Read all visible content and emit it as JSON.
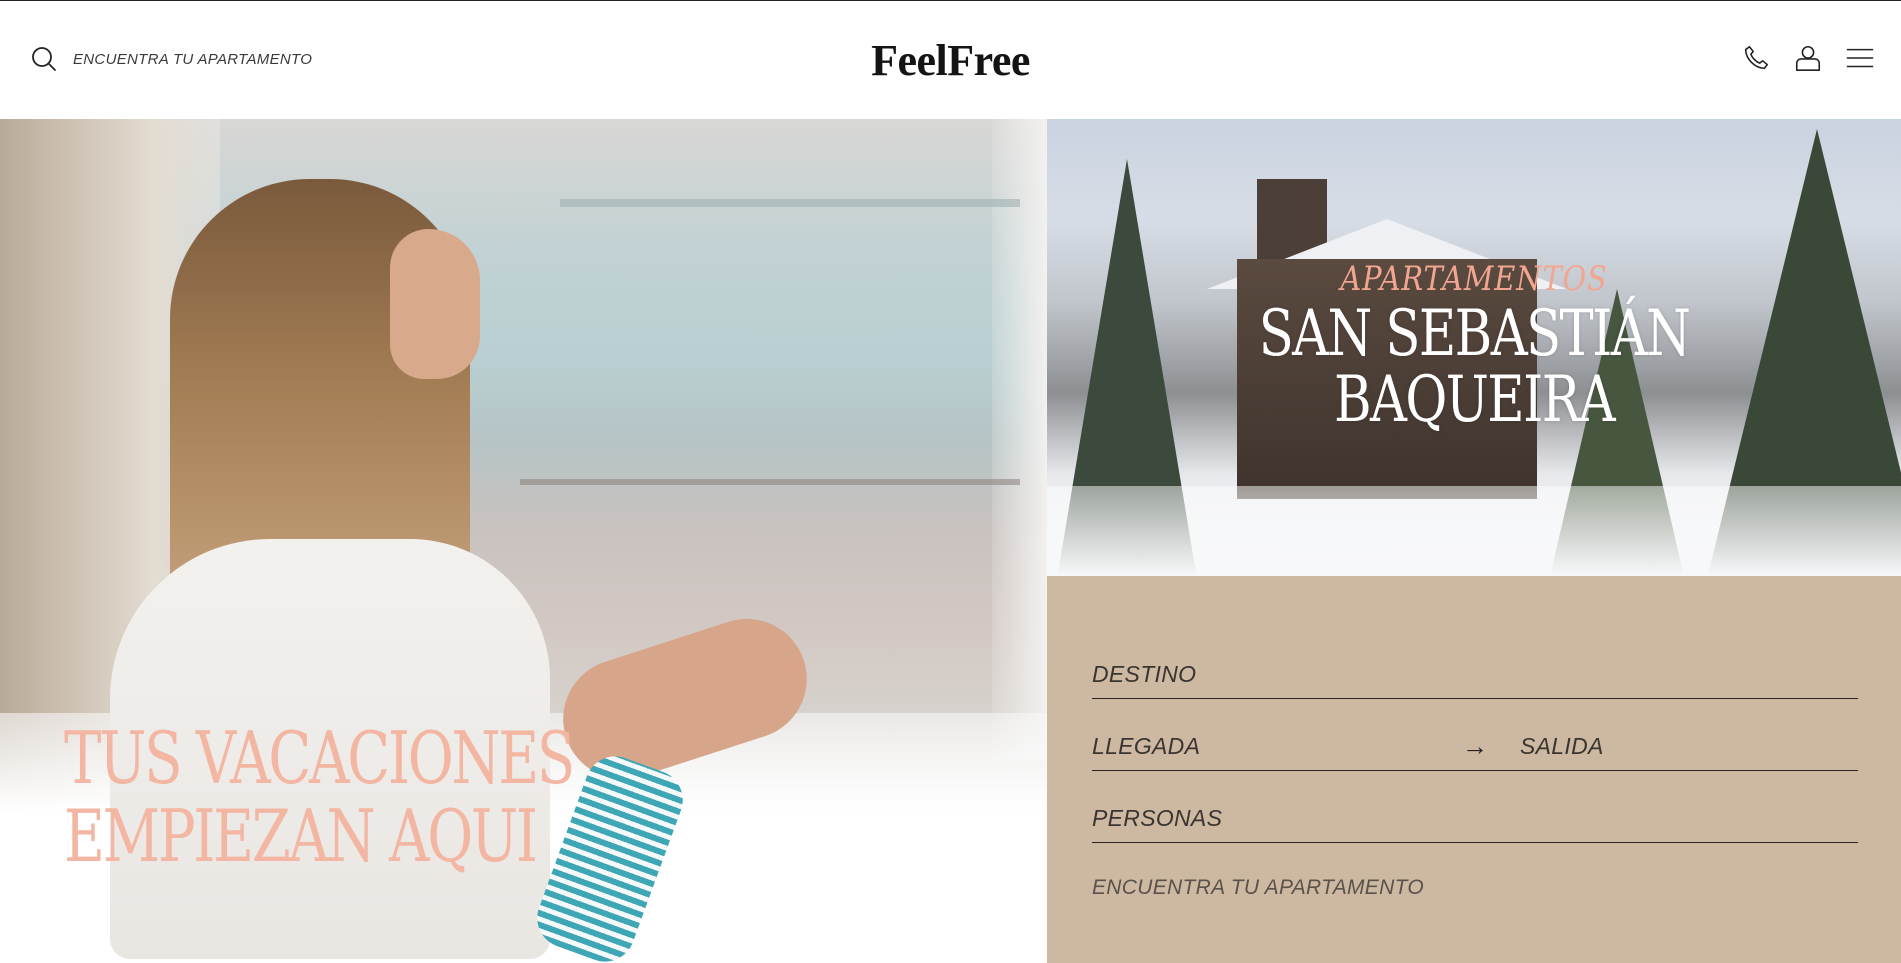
{
  "header": {
    "search_placeholder": "ENCUENTRA TU APARTAMENTO",
    "logo": "FeelFree",
    "icons": [
      "phone-icon",
      "user-icon",
      "menu-icon"
    ]
  },
  "hero_left": {
    "headline_line1": "TUS VACACIONES",
    "headline_line2": "EMPIEZAN AQUI"
  },
  "hero_right": {
    "eyebrow": "APARTAMENTOS",
    "destination_line1": "SAN SEBASTIÁN",
    "destination_line2": "BAQUEIRA"
  },
  "booking": {
    "destino": "DESTINO",
    "llegada": "LLEGADA",
    "arrow": "→",
    "salida": "SALIDA",
    "personas": "PERSONAS",
    "submit": "ENCUENTRA TU APARTAMENTO"
  },
  "colors": {
    "booking_bg": "#cdb9a1",
    "accent_salmon": "#f2b6a2"
  }
}
